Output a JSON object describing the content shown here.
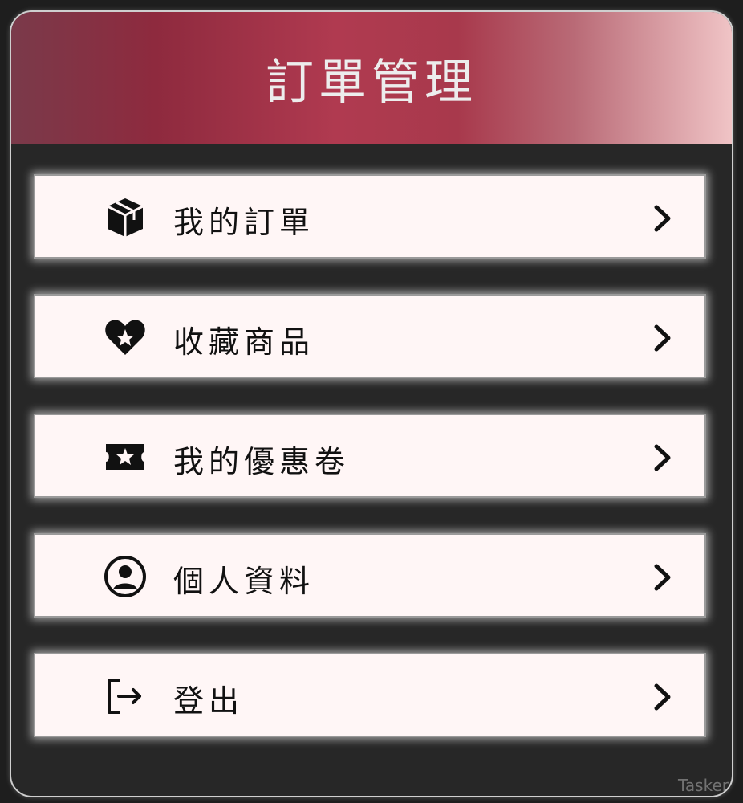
{
  "header": {
    "title": "訂單管理"
  },
  "menu": [
    {
      "label": "我的訂單",
      "icon": "package-icon"
    },
    {
      "label": "收藏商品",
      "icon": "heart-star-icon"
    },
    {
      "label": "我的優惠卷",
      "icon": "ticket-star-icon"
    },
    {
      "label": "個人資料",
      "icon": "user-circle-icon"
    },
    {
      "label": "登出",
      "icon": "logout-icon"
    }
  ],
  "watermark": "Tasker",
  "colors": {
    "header_gradient_start": "#7a3a4a",
    "header_gradient_mid": "#b03a50",
    "header_gradient_end": "#f0c4c6",
    "item_background": "#fff6f6",
    "panel_background": "#272727"
  }
}
